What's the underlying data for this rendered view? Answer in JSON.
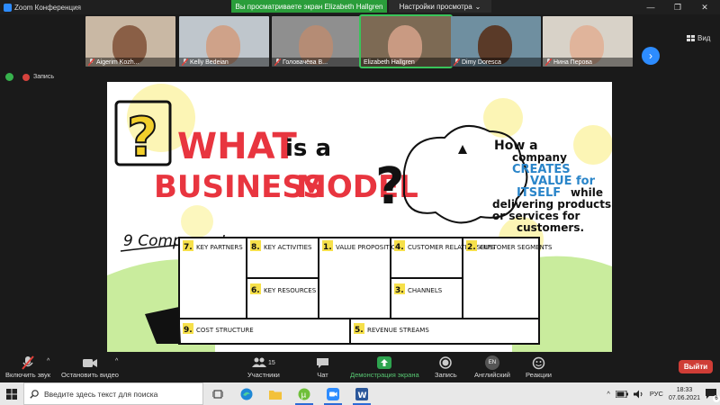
{
  "window": {
    "title": "Zoom Конференция",
    "share_banner": "Вы просматриваете экран Elizabeth Hallgren",
    "view_options": "Настройки просмотра",
    "view_toggle": "Вид"
  },
  "participants": [
    {
      "name": "Aigerim Kozh...",
      "muted": true,
      "bg": "#c9b8a4",
      "face": "#8a5f46",
      "active": false
    },
    {
      "name": "Kelly Bedeian",
      "muted": true,
      "bg": "#bfc6cc",
      "face": "#cfa289",
      "active": false
    },
    {
      "name": "Головачёва В...",
      "muted": true,
      "bg": "#8f8f8f",
      "face": "#b58c75",
      "active": false
    },
    {
      "name": "Elizabeth Hallgren",
      "muted": false,
      "bg": "#7d6a54",
      "face": "#c99a82",
      "active": true
    },
    {
      "name": "Dimy Doresca",
      "muted": true,
      "bg": "#6f8fa0",
      "face": "#5a3a28",
      "active": false
    },
    {
      "name": "Нина Перова",
      "muted": true,
      "bg": "#d8d2c8",
      "face": "#e0b49b",
      "active": false
    }
  ],
  "status": {
    "recording_label": "Запись"
  },
  "slide": {
    "title_q": "?",
    "title_what": "WHAT",
    "title_is": "is a",
    "title_business": "BUSINESS",
    "title_model": "MODEL",
    "big_q": "?",
    "tagline": [
      "How a",
      "company",
      "CREATES",
      "VALUE for",
      "ITSELF",
      "while",
      "delivering products",
      "or services for",
      "customers."
    ],
    "components_label": "9 Components...",
    "blocks": [
      {
        "num": "7.",
        "text": "KEY PARTNERS"
      },
      {
        "num": "8.",
        "text": "KEY ACTIVITIES"
      },
      {
        "num": "1.",
        "text": "VALUE PROPOSITIONS"
      },
      {
        "num": "4.",
        "text": "CUSTOMER RELATIONSHIPS"
      },
      {
        "num": "2.",
        "text": "CUSTOMER SEGMENTS"
      },
      {
        "num": "6.",
        "text": "KEY RESOURCES"
      },
      {
        "num": "3.",
        "text": "CHANNELS"
      },
      {
        "num": "9.",
        "text": "COST STRUCTURE"
      },
      {
        "num": "5.",
        "text": "REVENUE STREAMS"
      }
    ]
  },
  "toolbar": {
    "audio": "Включить звук",
    "video": "Остановить видео",
    "participants": "Участники",
    "participants_count": "15",
    "chat": "Чат",
    "share": "Демонстрация экрана",
    "record": "Запись",
    "language_badge": "EN",
    "language": "Английский",
    "reactions": "Реакции",
    "leave": "Выйти"
  },
  "taskbar": {
    "search_placeholder": "Введите здесь текст для поиска",
    "lang": "РУС",
    "time": "18:33",
    "date": "07.06.2021",
    "notif_count": "6"
  }
}
